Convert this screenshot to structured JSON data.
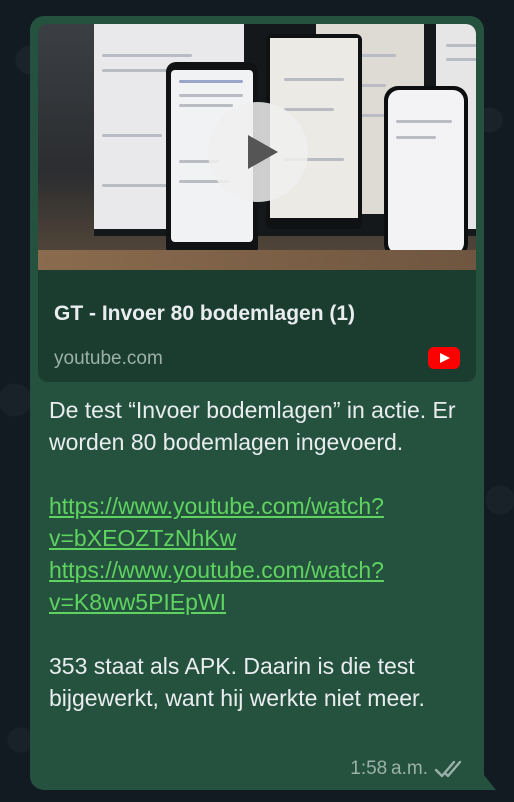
{
  "message": {
    "link_preview": {
      "title": "GT - Invoer 80 bodemlagen (1)",
      "domain": "youtube.com",
      "thumbnail_icon": "play-icon",
      "site_icon": "youtube-icon"
    },
    "paragraph1": "De test “Invoer bodemlagen” in actie. Er worden 80 bodemlagen ingevoerd.",
    "link1_line1": "https://www.youtube.com/watch?",
    "link1_line2": "v=bXEOZTzNhKw",
    "link2_line1": "https://www.youtube.com/watch?",
    "link2_line2": "v=K8ww5PIEpWI",
    "paragraph2": "353 staat als APK. Daarin is die test bijgewerkt, want hij werkte niet meer.",
    "time": "1:58 a.m.",
    "status_icon": "double-check-icon"
  },
  "colors": {
    "bubble": "#24523f",
    "link": "#5fd35f",
    "text": "#e9edef",
    "meta": "#9bb0a8"
  }
}
